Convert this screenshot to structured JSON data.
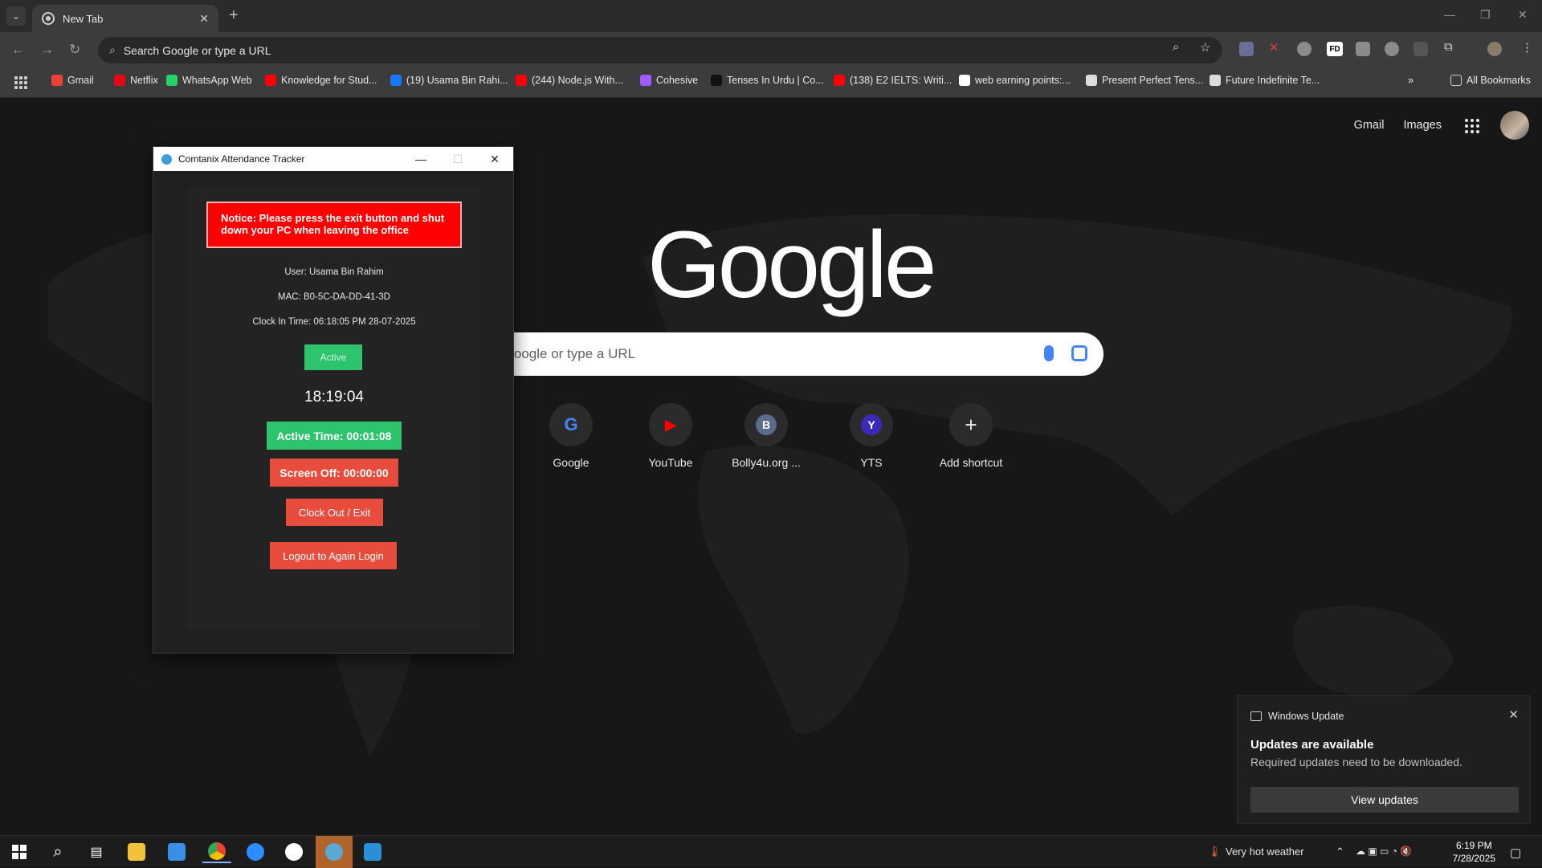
{
  "browser": {
    "tab_title": "New Tab",
    "omnibox_text": "Search Google or type a URL",
    "ext_fd_label": "FD",
    "bookmarks": [
      {
        "label": "Gmail",
        "color": "#ea4335"
      },
      {
        "label": "Netflix",
        "color": "#e50914"
      },
      {
        "label": "WhatsApp Web",
        "color": "#25d366"
      },
      {
        "label": "Knowledge for Stud...",
        "color": "#ff0000"
      },
      {
        "label": "(19) Usama Bin Rahi...",
        "color": "#1877f2"
      },
      {
        "label": "(244) Node.js With...",
        "color": "#ff0000"
      },
      {
        "label": "Cohesive",
        "color": "#a259ff"
      },
      {
        "label": "Tenses In Urdu | Co...",
        "color": "#111111"
      },
      {
        "label": "(138) E2 IELTS: Writi...",
        "color": "#ff0000"
      },
      {
        "label": "web earning points:...",
        "color": "#ffffff"
      },
      {
        "label": "Present Perfect Tens...",
        "color": "#dddddd"
      },
      {
        "label": "Future Indefinite Te...",
        "color": "#dddddd"
      }
    ],
    "all_bookmarks": "All Bookmarks"
  },
  "ntp": {
    "gmail": "Gmail",
    "images": "Images",
    "logo": "Google",
    "search_placeholder": "ch Google or type a URL",
    "shortcuts": [
      {
        "label": "Google",
        "glyph": "G",
        "color": "#4285f4"
      },
      {
        "label": "YouTube",
        "glyph": "▶",
        "color": "#ff0000"
      },
      {
        "label": "Bolly4u.org ...",
        "glyph": "B",
        "color": "#5b6b8c"
      },
      {
        "label": "YTS",
        "glyph": "Y",
        "color": "#3b2ab8"
      },
      {
        "label": "Add shortcut",
        "glyph": "+",
        "color": "#2b2b2b"
      }
    ]
  },
  "tracker": {
    "title": "Comtanix Attendance Tracker",
    "notice": "Notice: Please press the exit button and shut down your PC when leaving the office",
    "user": "User: Usama Bin Rahim",
    "mac": "MAC: B0-5C-DA-DD-41-3D",
    "clock_in": "Clock In Time: 06:18:05 PM 28-07-2025",
    "status": "Active",
    "clock": "18:19:04",
    "active_time": "Active Time: 00:01:08",
    "screen_off": "Screen Off: 00:00:00",
    "clock_out": "Clock Out / Exit",
    "logout": "Logout to Again Login",
    "colors": {
      "notice": "#ff0000",
      "active": "#2ec46e",
      "danger": "#e74c3c"
    }
  },
  "toast": {
    "app": "Windows Update",
    "title": "Updates are available",
    "message": "Required updates need to be downloaded.",
    "button": "View updates"
  },
  "taskbar": {
    "weather": "Very hot weather",
    "time": "6:19 PM",
    "date": "7/28/2025"
  }
}
